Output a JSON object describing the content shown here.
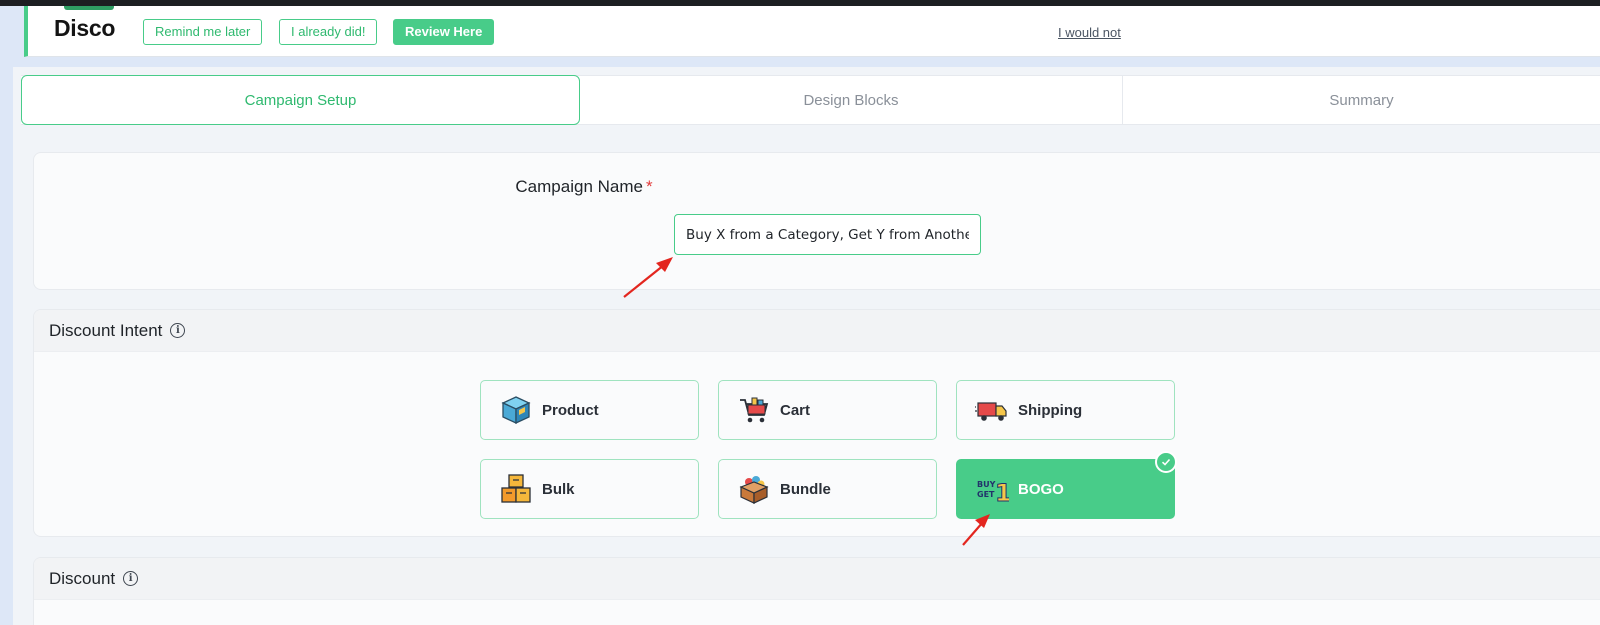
{
  "notice": {
    "title": "Disco",
    "remind_label": "Remind me later",
    "already_label": "I already did!",
    "review_label": "Review Here",
    "decline_link": "I would not"
  },
  "tabs": [
    {
      "label": "Campaign Setup",
      "active": true
    },
    {
      "label": "Design Blocks",
      "active": false
    },
    {
      "label": "Summary",
      "active": false
    }
  ],
  "campaign": {
    "label": "Campaign Name",
    "required_mark": "*",
    "value": "Buy X from a Category, Get Y from Anothe"
  },
  "intent": {
    "title": "Discount Intent",
    "info_glyph": "i",
    "options": [
      {
        "label": "Product",
        "icon": "box-icon",
        "selected": false
      },
      {
        "label": "Cart",
        "icon": "cart-icon",
        "selected": false
      },
      {
        "label": "Shipping",
        "icon": "truck-icon",
        "selected": false
      },
      {
        "label": "Bulk",
        "icon": "stacked-boxes-icon",
        "selected": false
      },
      {
        "label": "Bundle",
        "icon": "bundle-box-icon",
        "selected": false
      },
      {
        "label": "BOGO",
        "icon": "buy-get-one-icon",
        "selected": true
      }
    ]
  },
  "discount": {
    "title": "Discount",
    "info_glyph": "i"
  },
  "colors": {
    "accent": "#48cc89",
    "annotation_arrow": "#e3261f"
  }
}
